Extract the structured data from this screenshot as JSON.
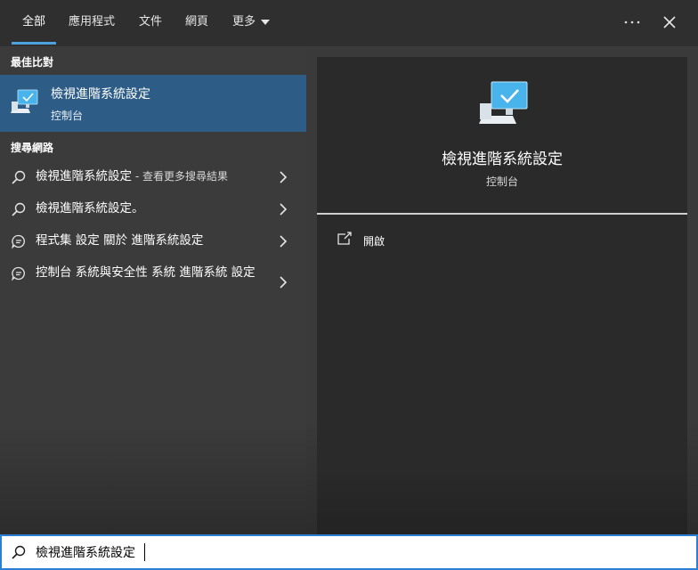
{
  "tabs": [
    {
      "label": "全部",
      "active": true
    },
    {
      "label": "應用程式",
      "active": false
    },
    {
      "label": "文件",
      "active": false
    },
    {
      "label": "網頁",
      "active": false
    },
    {
      "label": "更多",
      "active": false
    }
  ],
  "topbar": {
    "more_options_icon": "ellipsis-icon",
    "close_icon": "close-icon"
  },
  "best_match": {
    "section_title": "最佳比對",
    "title": "檢視進階系統設定",
    "subtitle": "控制台",
    "icon": "computer-settings-icon"
  },
  "web_search": {
    "section_title": "搜尋網路",
    "results": [
      {
        "text": "檢視進階系統設定",
        "suffix": " - 查看更多搜尋結果",
        "icon": "search-icon"
      },
      {
        "text": "檢視進階系統設定。",
        "suffix": "",
        "icon": "search-icon"
      },
      {
        "text": "程式集 設定 關於 進階系統設定",
        "suffix": "",
        "icon": "chat-bubble-icon"
      },
      {
        "text": "控制台 系統與安全性 系統 進階系統 設定",
        "suffix": "",
        "icon": "chat-bubble-icon"
      }
    ]
  },
  "preview": {
    "title": "檢視進階系統設定",
    "subtitle": "控制台",
    "actions": [
      {
        "label": "開啟",
        "icon": "open-external-icon"
      }
    ]
  },
  "search": {
    "value": "檢視進階系統設定",
    "icon": "search-icon"
  },
  "colors": {
    "accent": "#4aa3df",
    "selection": "#2d5d87",
    "search_border": "#2d7fd3"
  }
}
